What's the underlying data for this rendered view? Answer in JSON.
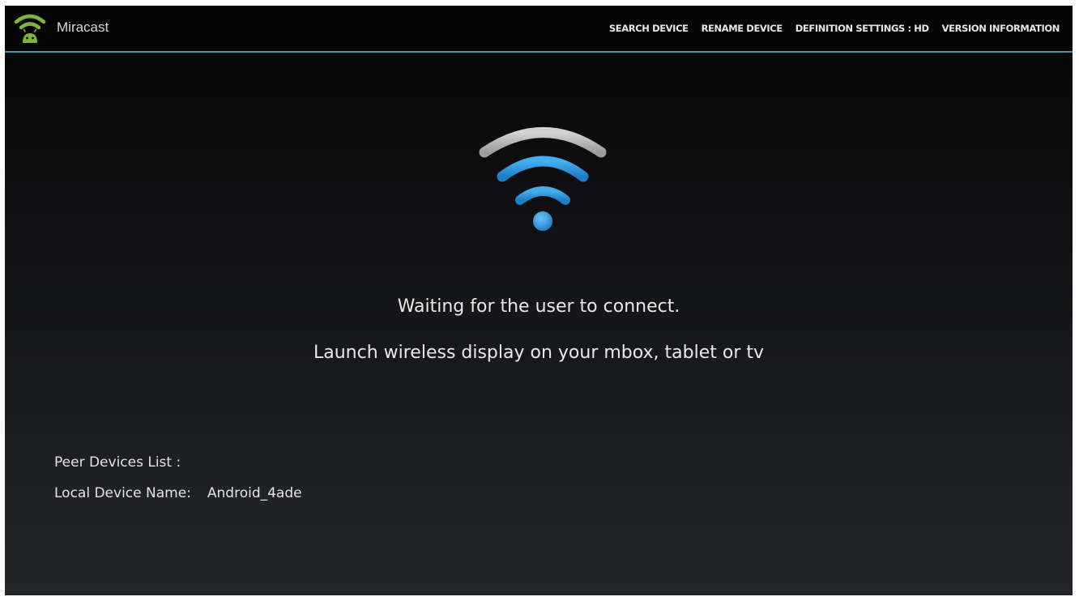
{
  "app": {
    "title": "Miracast",
    "logo_icon": "miracast-wifi-android-icon"
  },
  "menu": {
    "items": [
      {
        "label": "SEARCH DEVICE"
      },
      {
        "label": "RENAME DEVICE"
      },
      {
        "label": "DEFINITION SETTINGS : HD"
      },
      {
        "label": "VERSION INFORMATION"
      }
    ]
  },
  "main": {
    "graphic_icon": "wifi-signal-icon",
    "status": {
      "waiting": "Waiting for the user to connect.",
      "instruction": "Launch wireless display on your mbox, tablet or tv"
    },
    "peer_devices_label": "Peer Devices List :",
    "local_device_label": "Local Device Name:",
    "local_device_value": "Android_4ade"
  },
  "colors": {
    "accent_blue": "#2f93d8",
    "arc_gray": "#b9b9b9",
    "logo_green": "#7cb342",
    "divider": "#4a8ea3"
  }
}
